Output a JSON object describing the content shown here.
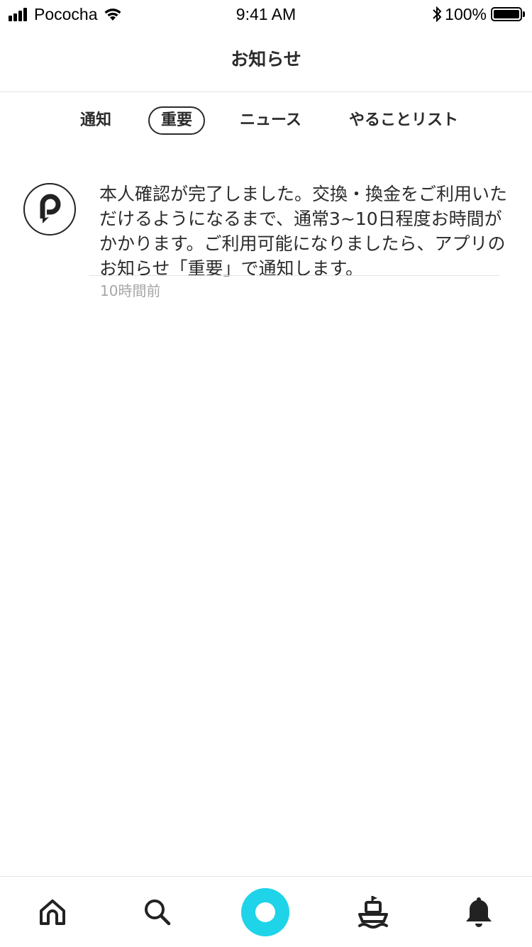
{
  "status_bar": {
    "carrier": "Pococha",
    "time": "9:41 AM",
    "battery_percent": "100%"
  },
  "header": {
    "title": "お知らせ"
  },
  "tabs": [
    {
      "label": "通知",
      "active": false
    },
    {
      "label": "重要",
      "active": true
    },
    {
      "label": "ニュース",
      "active": false
    },
    {
      "label": "やることリスト",
      "active": false
    }
  ],
  "notices": [
    {
      "icon": "pococha-logo-icon",
      "message": "本人確認が完了しました。交換・換金をご利用いただけるようになるまで、通常3~10日程度お時間がかかります。ご利用可能になりましたら、アプリのお知らせ「重要」で通知します。",
      "time": "10時間前"
    }
  ],
  "tab_bar": {
    "items": [
      "home-icon",
      "search-icon",
      "live-button",
      "ship-icon",
      "bell-icon"
    ],
    "accent_color": "#1fd3e8"
  }
}
